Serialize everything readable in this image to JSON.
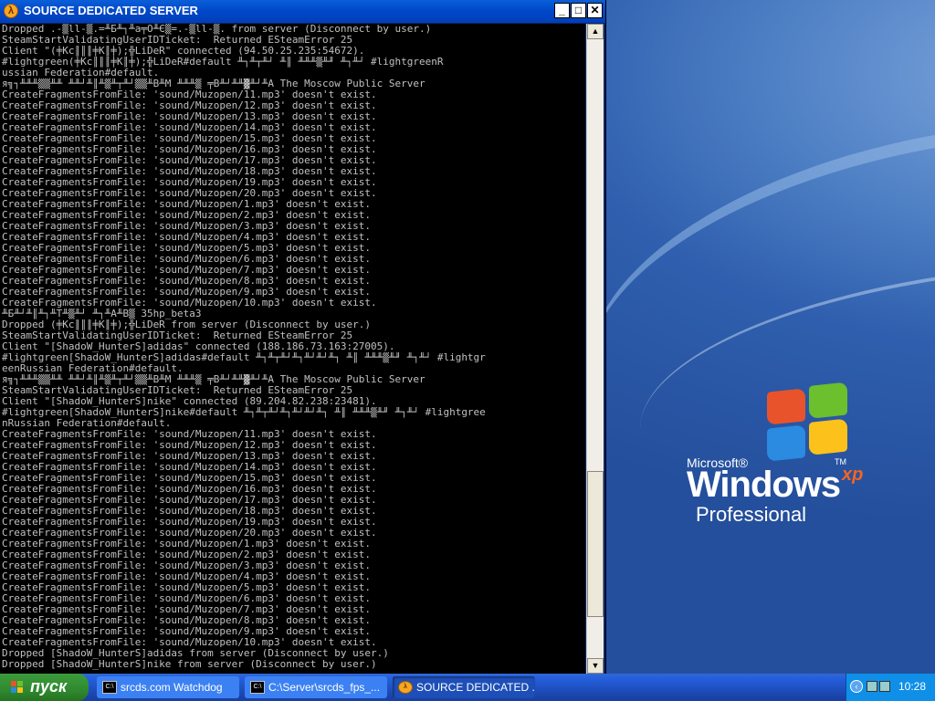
{
  "window": {
    "title": "SOURCE DEDICATED SERVER",
    "icon": "half-life-icon",
    "controls": {
      "minimize": "_",
      "maximize": "□",
      "close": "✕"
    }
  },
  "console": {
    "lines": [
      "Dropped .-▒ll-▒.=╨Б╨┐╨а╤О╨Є▒=.-▒ll-▒. from server (Disconnect by user.)",
      "SteamStartValidatingUserIDTicket:  Returned ESteamError 25",
      "Client \"(╪Kc║║║╪K║╪);╬LiDeR\" connected (94.50.25.235:54672).",
      "#lightgreen(╪Kc║║║╪K║╪);╬LiDeR#default ╨┐╨┬╨┘ ╨║ ╨╨╨▒╨╜ ╨┐╨┘ #lightgreenR",
      "ussian Federation#default.",
      "я╗┐╨╨╨▒▒╨╨ ╨╨┘╨║╨▒╨┬╨┘▒▒╨В╨М ╨╨╨▒ ╤В╨┘╨╨▓╨┘╨А The Moscow Public Server",
      "CreateFragmentsFromFile: 'sound/Muzopen/11.mp3' doesn't exist.",
      "CreateFragmentsFromFile: 'sound/Muzopen/12.mp3' doesn't exist.",
      "CreateFragmentsFromFile: 'sound/Muzopen/13.mp3' doesn't exist.",
      "CreateFragmentsFromFile: 'sound/Muzopen/14.mp3' doesn't exist.",
      "CreateFragmentsFromFile: 'sound/Muzopen/15.mp3' doesn't exist.",
      "CreateFragmentsFromFile: 'sound/Muzopen/16.mp3' doesn't exist.",
      "CreateFragmentsFromFile: 'sound/Muzopen/17.mp3' doesn't exist.",
      "CreateFragmentsFromFile: 'sound/Muzopen/18.mp3' doesn't exist.",
      "CreateFragmentsFromFile: 'sound/Muzopen/19.mp3' doesn't exist.",
      "CreateFragmentsFromFile: 'sound/Muzopen/20.mp3' doesn't exist.",
      "CreateFragmentsFromFile: 'sound/Muzopen/1.mp3' doesn't exist.",
      "CreateFragmentsFromFile: 'sound/Muzopen/2.mp3' doesn't exist.",
      "CreateFragmentsFromFile: 'sound/Muzopen/3.mp3' doesn't exist.",
      "CreateFragmentsFromFile: 'sound/Muzopen/4.mp3' doesn't exist.",
      "CreateFragmentsFromFile: 'sound/Muzopen/5.mp3' doesn't exist.",
      "CreateFragmentsFromFile: 'sound/Muzopen/6.mp3' doesn't exist.",
      "CreateFragmentsFromFile: 'sound/Muzopen/7.mp3' doesn't exist.",
      "CreateFragmentsFromFile: 'sound/Muzopen/8.mp3' doesn't exist.",
      "CreateFragmentsFromFile: 'sound/Muzopen/9.mp3' doesn't exist.",
      "CreateFragmentsFromFile: 'sound/Muzopen/10.mp3' doesn't exist.",
      "╨Б╨┘╨║╨┐╨Т╨▒╨┘ ╨┐╨А╨В▒ 35hp_beta3",
      "Dropped (╪Kc║║║╪K║╪);╬LiDeR from server (Disconnect by user.)",
      "SteamStartValidatingUserIDTicket:  Returned ESteamError 25",
      "Client \"[ShadoW_HunterS]adidas\" connected (188.186.73.163:27005).",
      "#lightgreen[ShadoW_HunterS]adidas#default ╨┐╨┬╨┘╨┐╨┘╨┘╨┐ ╨║ ╨╨╨▒╨╜ ╨┐╨┘ #lightgr",
      "eenRussian Federation#default.",
      "я╗┐╨╨╨▒▒╨╨ ╨╨┘╨║╨▒╨┬╨┘▒▒╨В╨М ╨╨╨▒ ╤В╨┘╨╨▓╨┘╨А The Moscow Public Server",
      "SteamStartValidatingUserIDTicket:  Returned ESteamError 25",
      "Client \"[ShadoW_HunterS]nike\" connected (89.204.82.238:23481).",
      "#lightgreen[ShadoW_HunterS]nike#default ╨┐╨┬╨┘╨┐╨┘╨┘╨┐ ╨║ ╨╨╨▒╨╜ ╨┐╨┘ #lightgree",
      "nRussian Federation#default.",
      "CreateFragmentsFromFile: 'sound/Muzopen/11.mp3' doesn't exist.",
      "CreateFragmentsFromFile: 'sound/Muzopen/12.mp3' doesn't exist.",
      "CreateFragmentsFromFile: 'sound/Muzopen/13.mp3' doesn't exist.",
      "CreateFragmentsFromFile: 'sound/Muzopen/14.mp3' doesn't exist.",
      "CreateFragmentsFromFile: 'sound/Muzopen/15.mp3' doesn't exist.",
      "CreateFragmentsFromFile: 'sound/Muzopen/16.mp3' doesn't exist.",
      "CreateFragmentsFromFile: 'sound/Muzopen/17.mp3' doesn't exist.",
      "CreateFragmentsFromFile: 'sound/Muzopen/18.mp3' doesn't exist.",
      "CreateFragmentsFromFile: 'sound/Muzopen/19.mp3' doesn't exist.",
      "CreateFragmentsFromFile: 'sound/Muzopen/20.mp3' doesn't exist.",
      "CreateFragmentsFromFile: 'sound/Muzopen/1.mp3' doesn't exist.",
      "CreateFragmentsFromFile: 'sound/Muzopen/2.mp3' doesn't exist.",
      "CreateFragmentsFromFile: 'sound/Muzopen/3.mp3' doesn't exist.",
      "CreateFragmentsFromFile: 'sound/Muzopen/4.mp3' doesn't exist.",
      "CreateFragmentsFromFile: 'sound/Muzopen/5.mp3' doesn't exist.",
      "CreateFragmentsFromFile: 'sound/Muzopen/6.mp3' doesn't exist.",
      "CreateFragmentsFromFile: 'sound/Muzopen/7.mp3' doesn't exist.",
      "CreateFragmentsFromFile: 'sound/Muzopen/8.mp3' doesn't exist.",
      "CreateFragmentsFromFile: 'sound/Muzopen/9.mp3' doesn't exist.",
      "CreateFragmentsFromFile: 'sound/Muzopen/10.mp3' doesn't exist.",
      "Dropped [ShadoW_HunterS]adidas from server (Disconnect by user.)",
      "Dropped [ShadoW_HunterS]nike from server (Disconnect by user.)"
    ]
  },
  "desktop": {
    "logo": {
      "microsoft": "Microsoft®",
      "windows": "Windows",
      "xp": "xp",
      "tm": "TM",
      "edition": "Professional"
    }
  },
  "taskbar": {
    "start_label": "пуск",
    "tasks": [
      {
        "label": "srcds.com Watchdog",
        "icon": "console-icon",
        "active": false
      },
      {
        "label": "C:\\Server\\srcds_fps_...",
        "icon": "console-icon",
        "active": false
      },
      {
        "label": "SOURCE DEDICATED ...",
        "icon": "half-life-icon",
        "active": true
      }
    ],
    "clock": "10:28"
  }
}
